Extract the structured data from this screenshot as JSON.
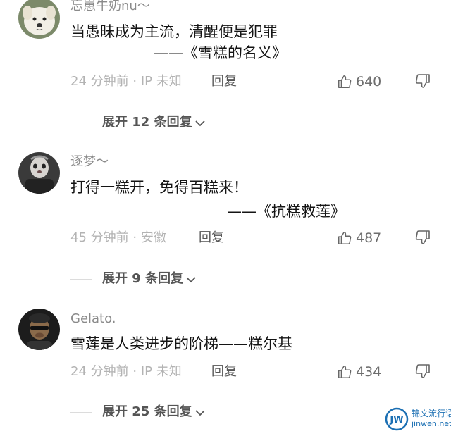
{
  "comments": [
    {
      "username": "忘崽牛奶nu～",
      "text": "当愚昧成为主流，清醒便是犯罪",
      "quote": "——《雪糕的名义》",
      "time": "24 分钟前",
      "location": "· IP 未知",
      "reply_label": "回复",
      "likes": "640",
      "expand_label": "展开 12 条回复"
    },
    {
      "username": "逐梦～",
      "text": "打得一糕开，免得百糕来！",
      "quote": "——《抗糕救莲》",
      "time": "45 分钟前",
      "location": "· 安徽",
      "reply_label": "回复",
      "likes": "487",
      "expand_label": "展开 9 条回复"
    },
    {
      "username": "Gelato.",
      "text": "雪莲是人类进步的阶梯——糕尔基",
      "time": "24 分钟前",
      "location": "· IP 未知",
      "reply_label": "回复",
      "likes": "434",
      "expand_label": "展开 25 条回复"
    }
  ],
  "icons": {
    "like": "thumbs-up-icon",
    "dislike": "thumbs-down-icon",
    "expand": "chevron-down-icon"
  },
  "watermark": {
    "logo": "JW",
    "line1": "锦文流行语",
    "line2": "jinwen.net"
  },
  "colors": {
    "text_primary": "#141414",
    "text_secondary": "#8a8a8a",
    "meta": "#b3b3b3",
    "watermark": "#1b6fb3"
  }
}
